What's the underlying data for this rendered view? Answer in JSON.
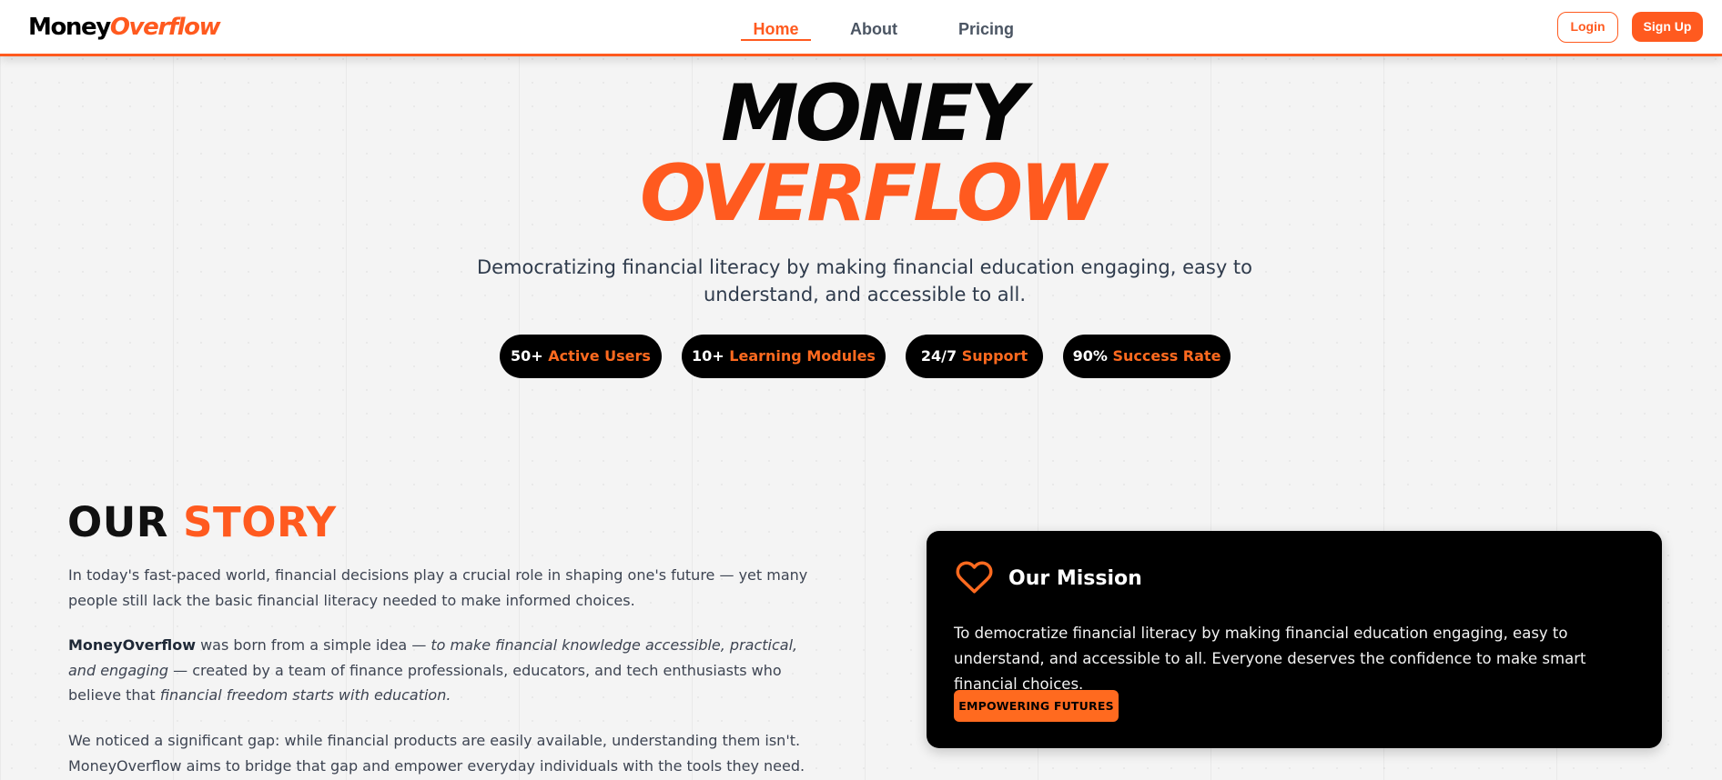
{
  "nav": {
    "logo_main": "Money",
    "logo_accent": "Overflow",
    "links": [
      "Home",
      "About",
      "Pricing"
    ],
    "login": "Login",
    "signup": "Sign Up"
  },
  "hero": {
    "title_line1": "MONEY",
    "title_line2": "OVERFLOW",
    "subtitle": "Democratizing financial literacy by making financial education engaging, easy to understand, and accessible to all.",
    "stats": [
      {
        "value": "50+",
        "label": "Active Users"
      },
      {
        "value": "10+",
        "label": "Learning Modules"
      },
      {
        "value": "24/7",
        "label": "Support"
      },
      {
        "value": "90%",
        "label": "Success Rate"
      }
    ]
  },
  "story": {
    "title_main": "OUR",
    "title_accent": "STORY",
    "p1": "In today's fast-paced world, financial decisions play a crucial role in shaping one's future — yet many people still lack the basic financial literacy needed to make informed choices.",
    "p2_brand": "MoneyOverflow",
    "p2_a": " was born from a simple idea — ",
    "p2_italic1": "to make financial knowledge accessible, practical, and engaging",
    "p2_b": " — created by a team of finance professionals, educators, and tech enthusiasts who believe that ",
    "p2_italic2": "financial freedom starts with education.",
    "p3": "We noticed a significant gap: while financial products are easily available, understanding them isn't. MoneyOverflow aims to bridge that gap and empower everyday individuals with the tools they need."
  },
  "mission": {
    "icon": "heart-icon",
    "title": "Our Mission",
    "text": "To democratize financial literacy by making financial education engaging, easy to understand, and accessible to all. Everyone deserves the confidence to make smart financial choices.",
    "badge": "EMPOWERING FUTURES"
  },
  "colors": {
    "accent": "#ff5a1f",
    "dark": "#000000",
    "background": "#f4f4f4"
  }
}
